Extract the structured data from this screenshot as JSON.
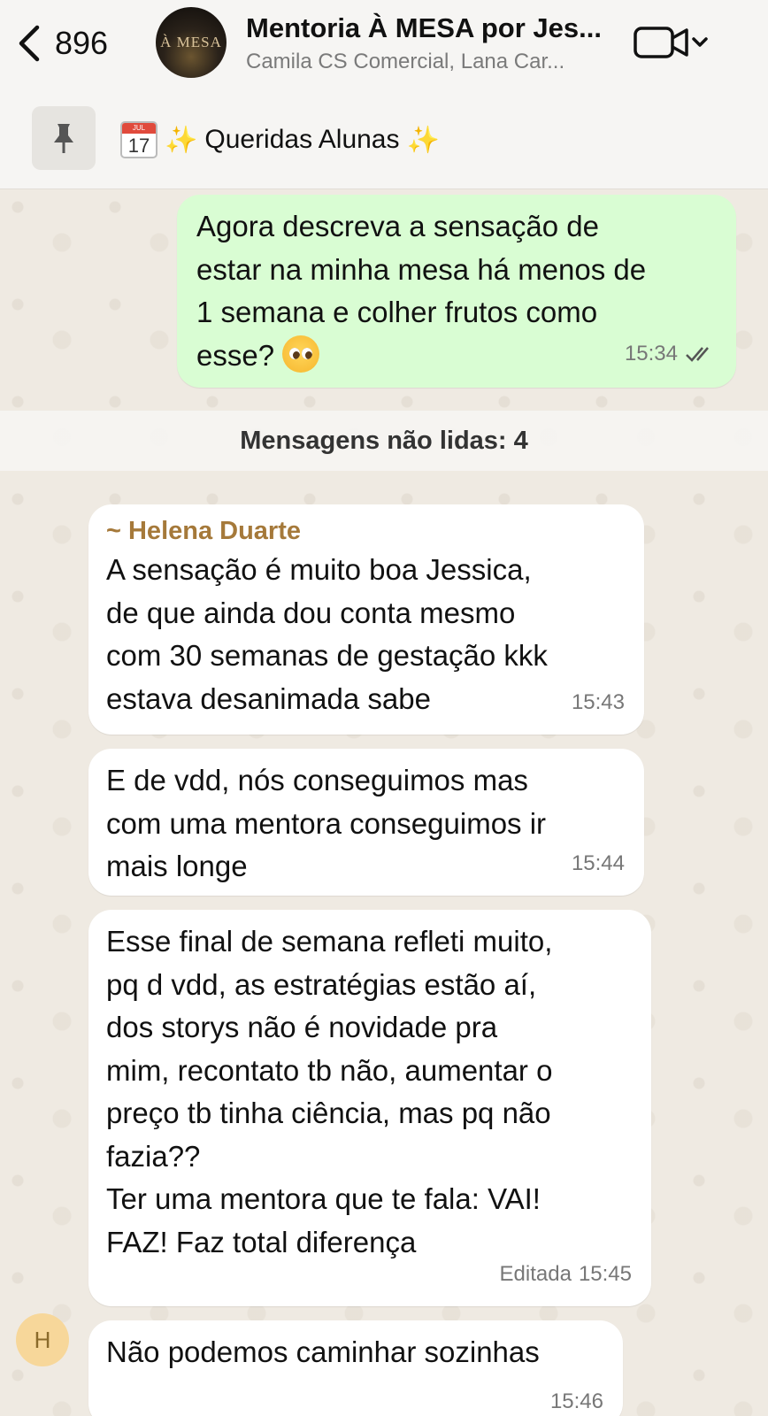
{
  "header": {
    "back_count": "896",
    "avatar_text": "À MESA",
    "title": "Mentoria À MESA por Jes...",
    "subtitle": "Camila CS Comercial, Lana Car...",
    "video_icon": "video-camera-icon"
  },
  "pinned": {
    "calendar_month": "JUL",
    "calendar_day": "17",
    "text": "Queridas Alunas",
    "sparkle": "✨"
  },
  "messages": [
    {
      "type": "outgoing",
      "text": "Agora descreva a sensação de\nestar na minha mesa há menos de\n1 semana e colher frutos como\nesse? ",
      "emoji": "pleading-face",
      "time": "15:34",
      "status": "read"
    },
    {
      "type": "incoming",
      "sender": "~ Helena Duarte",
      "text": "A sensação é muito boa Jessica,\nde que ainda dou conta mesmo\ncom 30 semanas de gestação kkk\nestava desanimada sabe",
      "time": "15:43"
    },
    {
      "type": "incoming",
      "text": "E de vdd, nós conseguimos mas\ncom uma mentora conseguimos ir\nmais longe",
      "time": "15:44"
    },
    {
      "type": "incoming",
      "text": "Esse final de semana refleti muito,\npq d vdd, as estratégias estão aí,\ndos storys não é novidade pra\nmim, recontato tb não, aumentar o\npreço tb tinha ciência, mas pq não\nfazia??\nTer uma mentora que te fala: VAI!\nFAZ! Faz total diferença",
      "edited_label": "Editada",
      "time": "15:45"
    },
    {
      "type": "incoming",
      "text": "Não podemos caminhar sozinhas",
      "time": "15:46"
    }
  ],
  "unread_label": "Mensagens não lidas: 4",
  "sender_avatar_initial": "H",
  "colors": {
    "outgoing_bubble": "#d9fdd3",
    "incoming_bubble": "#ffffff",
    "sender_name": "#a5793a",
    "chat_background": "#efeae2"
  }
}
